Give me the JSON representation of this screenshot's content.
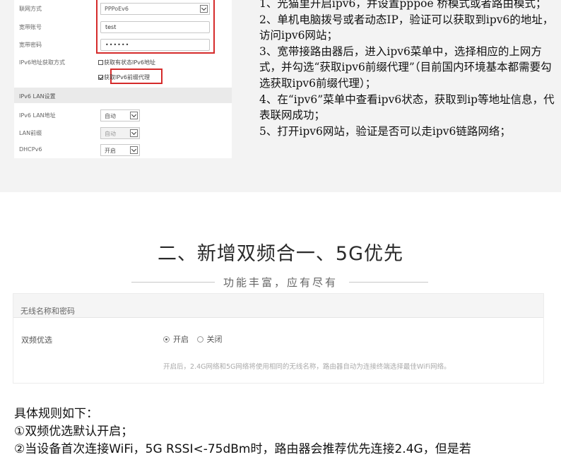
{
  "router_form": {
    "rows": [
      {
        "label": "联网方式",
        "value": "PPPoEv6"
      },
      {
        "label": "宽带账号",
        "value": "test"
      },
      {
        "label": "宽带密码",
        "value": "••••••"
      },
      {
        "label": "IPv6地址获取方式"
      }
    ],
    "stateful_checkbox": "获取有状态IPv6地址",
    "prefix_checkbox": "获取IPv6前缀代理",
    "lan_section_title": "IPv6 LAN设置",
    "lan_rows": [
      {
        "label": "IPv6 LAN地址",
        "value": "自动"
      },
      {
        "label": "LAN前缀",
        "value": "自动"
      },
      {
        "label": "DHCPv6",
        "value": "开启"
      }
    ]
  },
  "steps": [
    "1、光猫里开启ipv6，并设置pppoe 桥模式或者路由模式；",
    "2、单机电脑拨号或者动态IP，验证可以获取到ipv6的地址，访问ipv6网站；",
    "3、宽带接路由器后，进入ipv6菜单中，选择相应的上网方式，并勾选“获取ipv6前缀代理”（目前国内环境基本都需要勾选获取ipv6前缀代理）；",
    "4、在“ipv6”菜单中查看ipv6状态，获取到ip等地址信息，代表联网成功；",
    "5、打开ipv6网站，验证是否可以走ipv6链路网络；"
  ],
  "headline": "二、新增双频合一、5G优先",
  "subtitle": "功能丰富，应有尽有",
  "wireless_panel": {
    "title": "无线名称和密码",
    "setting_label": "双频优选",
    "option_on": "开启",
    "option_off": "关闭",
    "hint": "开启后，2.4G网络和5G网络将使用相同的无线名称，路由器自动为连接终端选择最佳WiFi网络。"
  },
  "rules": {
    "intro": "具体规则如下：",
    "items": [
      "①双频优选默认开启；",
      "②当设备首次连接WiFi，5G RSSI<-75dBm时，路由器会推荐优先连接2.4G，但是若"
    ]
  }
}
